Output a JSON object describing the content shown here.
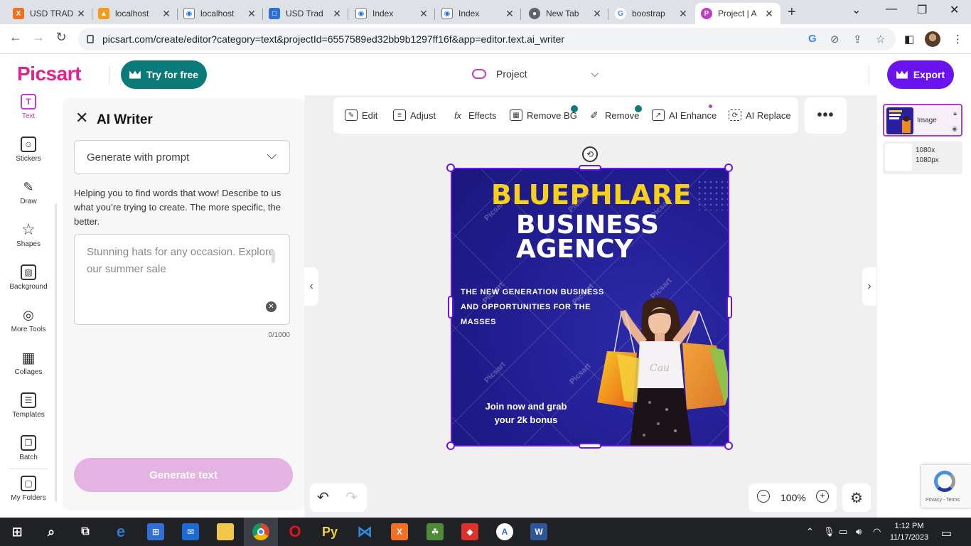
{
  "browser": {
    "tabs": [
      {
        "title": "USD TRAD",
        "icon": "xampp-icon",
        "color": "#f36f21"
      },
      {
        "title": "localhost",
        "icon": "phpmyadmin-icon",
        "color": "#f29b1d"
      },
      {
        "title": "localhost",
        "icon": "page-icon",
        "color": "#1a73e8"
      },
      {
        "title": "USD Trad",
        "icon": "usd-icon",
        "color": "#2f6fd6"
      },
      {
        "title": "Index",
        "icon": "index-icon",
        "color": "#1a73e8"
      },
      {
        "title": "Index",
        "icon": "index-icon",
        "color": "#1a73e8"
      },
      {
        "title": "New Tab",
        "icon": "chrome-icon",
        "color": "#5f6368"
      },
      {
        "title": "boostrap",
        "icon": "google-icon",
        "color": "#4285f4"
      },
      {
        "title": "Project | A",
        "icon": "picsart-icon",
        "color": "#c13cc6"
      }
    ],
    "url": "picsart.com/create/editor?category=text&projectId=6557589ed32bb9b1297ff16f&app=editor.text.ai_writer"
  },
  "header": {
    "logo": "Picsart",
    "try_free": "Try for free",
    "project": "Project",
    "export": "Export"
  },
  "rail": {
    "items": [
      {
        "label": "Text",
        "glyph": "T"
      },
      {
        "label": "Stickers",
        "glyph": "☺"
      },
      {
        "label": "Draw",
        "glyph": "✎"
      },
      {
        "label": "Shapes",
        "glyph": "☆"
      },
      {
        "label": "Background",
        "glyph": "▨"
      },
      {
        "label": "More Tools",
        "glyph": "◎"
      },
      {
        "label": "Collages",
        "glyph": "▦"
      },
      {
        "label": "Templates",
        "glyph": "☰"
      },
      {
        "label": "Batch",
        "glyph": "❐"
      },
      {
        "label": "My Folders",
        "glyph": "▢"
      }
    ]
  },
  "ai_writer": {
    "title": "AI Writer",
    "mode": "Generate with prompt",
    "helper": "Helping you to find words that wow! Describe to us what you’re trying to create. The more specific, the better.",
    "placeholder": "Stunning hats for any occasion. Explore our summer sale",
    "counter": "0/1000",
    "generate": "Generate text"
  },
  "toolbar": {
    "edit": "Edit",
    "adjust": "Adjust",
    "effects": "Effects",
    "remove_bg": "Remove BG",
    "remove": "Remove",
    "ai_enhance": "AI Enhance",
    "ai_replace": "AI Replace",
    "more": "•••"
  },
  "artboard": {
    "title1": "BLUEPHLARE",
    "title2_line1": "BUSINESS",
    "title2_line2": "AGENCY",
    "subtitle": "THE NEW GENERATION BUSINESS AND OPPORTUNITIES FOR THE MASSES",
    "cta": "Join now and grab your 2k bonus",
    "watermark": "Picsart"
  },
  "zoom": {
    "value": "100%",
    "minus": "−",
    "plus": "+"
  },
  "layers": {
    "items": [
      {
        "name": "Image"
      },
      {
        "name_line1": "1080x",
        "name_line2": "1080px"
      }
    ]
  },
  "recaptcha": {
    "text": "Privacy - Terms"
  },
  "taskbar": {
    "time": "1:12 PM",
    "date": "11/17/2023"
  }
}
